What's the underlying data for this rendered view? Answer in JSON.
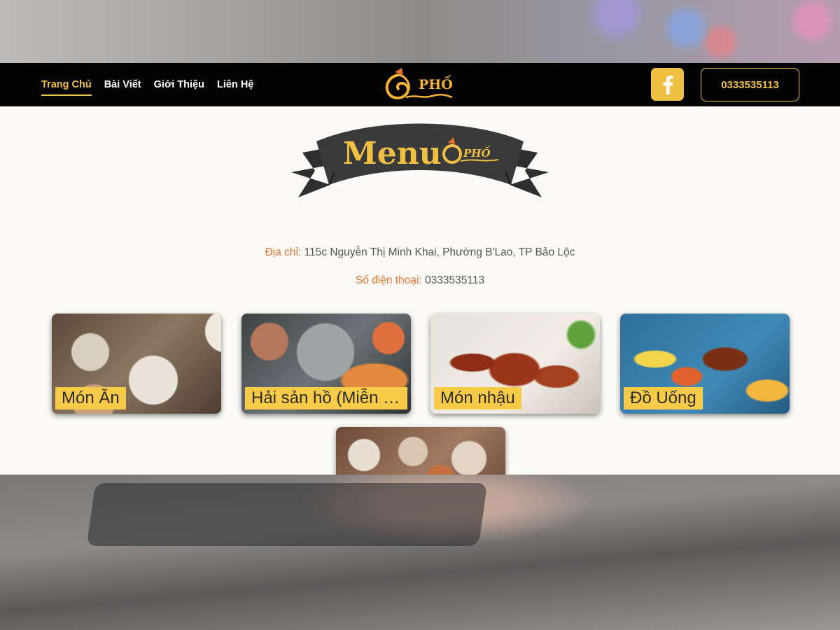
{
  "nav": {
    "items": [
      {
        "label": "Trang Chủ",
        "active": true
      },
      {
        "label": "Bài Viết",
        "active": false
      },
      {
        "label": "Giới Thiệu",
        "active": false
      },
      {
        "label": "Liên Hệ",
        "active": false
      }
    ]
  },
  "brand": {
    "logo_text": "PHỐ"
  },
  "header": {
    "phone_label": "0333535113",
    "facebook_icon": "facebook-icon"
  },
  "banner": {
    "menu_text": "Menu",
    "logo_text": "PHỐ"
  },
  "info": {
    "address_label": "Địa chỉ:",
    "address_value": "115c Nguyễn Thị Minh Khai, Phường B'Lao, TP Bảo Lộc",
    "phone_label": "Số điện thoại:",
    "phone_value": "0333535113"
  },
  "categories": [
    {
      "label": "Món Ăn"
    },
    {
      "label": "Hải sản hồ (Miễn phí chế biến)"
    },
    {
      "label": "Món nhậu"
    },
    {
      "label": "Đồ Uống"
    },
    {
      "label": ""
    }
  ],
  "colors": {
    "accent": "#f0c043",
    "label_orange": "#e5732a",
    "header_bg": "#030303"
  }
}
